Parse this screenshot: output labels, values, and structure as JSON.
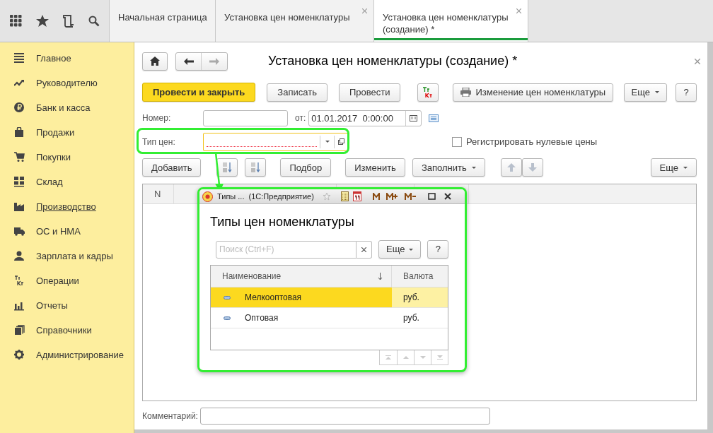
{
  "tabs": [
    {
      "label": "Начальная страница",
      "selected": false,
      "closable": false
    },
    {
      "label": "Установка цен номенклатуры",
      "selected": false,
      "closable": true
    },
    {
      "label": "Установка цен номенклатуры (создание) *",
      "selected": true,
      "closable": true
    }
  ],
  "sidebar": {
    "items": [
      {
        "label": "Главное",
        "hovered": false
      },
      {
        "label": "Руководителю",
        "hovered": false
      },
      {
        "label": "Банк и касса",
        "hovered": false
      },
      {
        "label": "Продажи",
        "hovered": false
      },
      {
        "label": "Покупки",
        "hovered": false
      },
      {
        "label": "Склад",
        "hovered": false
      },
      {
        "label": "Производство",
        "hovered": true
      },
      {
        "label": "ОС и НМА",
        "hovered": false
      },
      {
        "label": "Зарплата и кадры",
        "hovered": false
      },
      {
        "label": "Операции",
        "hovered": false
      },
      {
        "label": "Отчеты",
        "hovered": false
      },
      {
        "label": "Справочники",
        "hovered": false
      },
      {
        "label": "Администрирование",
        "hovered": false
      }
    ]
  },
  "form": {
    "title": "Установка цен номенклатуры (создание) *",
    "toolbar": [
      {
        "kind": "primary",
        "label": "Провести и закрыть"
      },
      {
        "kind": "plain",
        "label": "Записать"
      },
      {
        "kind": "plain",
        "label": "Провести"
      },
      {
        "kind": "dtkt"
      },
      {
        "kind": "print",
        "label": "Изменение цен номенклатуры"
      },
      {
        "kind": "menu",
        "label": "Еще"
      },
      {
        "kind": "plain",
        "label": "?"
      }
    ],
    "number_label": "Номер:",
    "date_label": "от:",
    "date_value": "01.01.2017  0:00:00",
    "price_type_label": "Тип цен:",
    "zero_prices": {
      "label": "Регистрировать нулевые цены",
      "checked": false
    },
    "table_toolbar": [
      {
        "kind": "plain",
        "label": "Добавить"
      },
      {
        "kind": "sort_asc"
      },
      {
        "kind": "sort_desc"
      },
      {
        "kind": "plain",
        "label": "Подбор"
      },
      {
        "kind": "plain",
        "label": "Изменить"
      },
      {
        "kind": "menu",
        "label": "Заполнить"
      },
      {
        "kind": "up"
      },
      {
        "kind": "down"
      },
      {
        "kind": "menu",
        "label": "Еще"
      }
    ],
    "table": {
      "columns": [
        {
          "label": "N"
        }
      ]
    },
    "comment_label": "Комментарий:"
  },
  "popup": {
    "title": "Типы ...  (1С:Предприятие)",
    "heading": "Типы цен номенклатуры",
    "search": {
      "placeholder": "Поиск (Ctrl+F)"
    },
    "more_button": "Еще",
    "help_button": "?",
    "columns": [
      "Наименование",
      "Валюта"
    ],
    "rows": [
      {
        "name": "Мелкооптовая",
        "currency": "руб.",
        "selected": true
      },
      {
        "name": "Оптовая",
        "currency": "руб.",
        "selected": false
      }
    ]
  }
}
